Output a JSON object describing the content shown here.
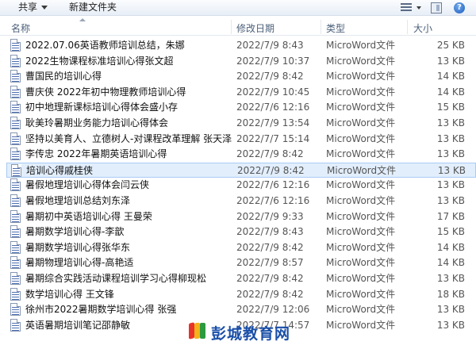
{
  "toolbar": {
    "share_label": "共享",
    "new_folder_label": "新建文件夹",
    "help_icon_glyph": "?"
  },
  "columns": {
    "name": "名称",
    "date": "修改日期",
    "type": "类型",
    "size": "大小"
  },
  "files": [
    {
      "name": "2022.07.06英语教师培训总结，朱娜",
      "date": "2022/7/9 8:43",
      "type": "MicroWord文件",
      "size": "25 KB"
    },
    {
      "name": "2022生物课程标准培训心得张文超",
      "date": "2022/7/9 10:37",
      "type": "MicroWord文件",
      "size": "13 KB"
    },
    {
      "name": "曹国民的培训心得",
      "date": "2022/7/9 8:42",
      "type": "MicroWord文件",
      "size": "14 KB"
    },
    {
      "name": "曹庆侠  2022年初中物理教师培训心得",
      "date": "2022/7/9 10:45",
      "type": "MicroWord文件",
      "size": "14 KB"
    },
    {
      "name": "初中地理新课标培训心得体会盛小存",
      "date": "2022/7/6 12:16",
      "type": "MicroWord文件",
      "size": "15 KB"
    },
    {
      "name": "耿美玲暑期业务能力培训心得体会",
      "date": "2022/7/9 13:54",
      "type": "MicroWord文件",
      "size": "13 KB"
    },
    {
      "name": "坚持以美育人、立德树人-对课程改革理解 张天泽",
      "date": "2022/7/7 15:14",
      "type": "MicroWord文件",
      "size": "13 KB"
    },
    {
      "name": "李传忠  2022年暑期英语培训心得",
      "date": "2022/7/9 8:42",
      "type": "MicroWord文件",
      "size": "13 KB"
    },
    {
      "name": "培训心得戚桂侠",
      "date": "2022/7/9 8:42",
      "type": "MicroWord文件",
      "size": "13 KB",
      "selected": true
    },
    {
      "name": "暑假地理培训心得体会闫云侠",
      "date": "2022/7/6 12:16",
      "type": "MicroWord文件",
      "size": "13 KB"
    },
    {
      "name": "暑假地理培训总结刘东泽",
      "date": "2022/7/6 12:16",
      "type": "MicroWord文件",
      "size": "13 KB"
    },
    {
      "name": "暑期初中英语培训心得  王曼荣",
      "date": "2022/7/9 9:33",
      "type": "MicroWord文件",
      "size": "17 KB"
    },
    {
      "name": "暑期数学培训心得-李歆",
      "date": "2022/7/9 8:43",
      "type": "MicroWord文件",
      "size": "15 KB"
    },
    {
      "name": "暑期数学培训心得张华东",
      "date": "2022/7/9 8:42",
      "type": "MicroWord文件",
      "size": "14 KB"
    },
    {
      "name": "暑期物理培训心得-高艳适",
      "date": "2022/7/9 8:57",
      "type": "MicroWord文件",
      "size": "14 KB"
    },
    {
      "name": "暑期综合实践活动课程培训学习心得柳现松",
      "date": "2022/7/9 8:42",
      "type": "MicroWord文件",
      "size": "13 KB"
    },
    {
      "name": "数学培训心得    王文锋",
      "date": "2022/7/9 8:42",
      "type": "MicroWord文件",
      "size": "18 KB"
    },
    {
      "name": "徐州市2022暑期数学培训心得    张强",
      "date": "2022/7/9 12:06",
      "type": "MicroWord文件",
      "size": "13 KB"
    },
    {
      "name": "英语暑期培训笔记邵静敏",
      "date": "2022/7/7 14:57",
      "type": "MicroWord文件",
      "size": "13 KB"
    }
  ],
  "watermark": {
    "text": "彭城教育网"
  },
  "colors": {
    "selection": "#e2eefc",
    "selection_border": "#a9cbf5",
    "header_text": "#4c607a",
    "watermark_text": "#1a4fa8"
  },
  "icons": {
    "file": "word-document-icon",
    "view": "view-options-icon",
    "pane": "preview-pane-icon",
    "help": "help-icon"
  }
}
